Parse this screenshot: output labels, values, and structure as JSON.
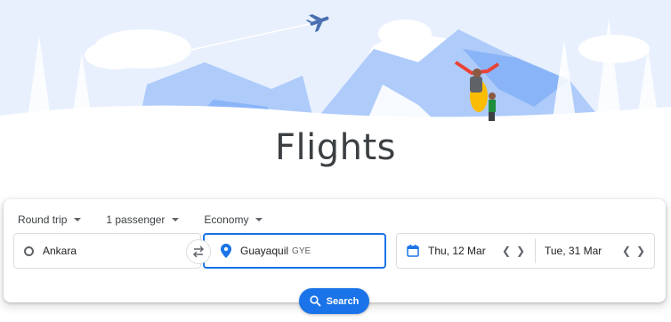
{
  "page": {
    "title": "Flights"
  },
  "options": {
    "trip_type": "Round trip",
    "passengers": "1 passenger",
    "cabin_class": "Economy"
  },
  "route": {
    "origin": "Ankara",
    "destination": "Guayaquil",
    "destination_code": "GYE"
  },
  "dates": {
    "departure": "Thu, 12 Mar",
    "return": "Tue, 31 Mar"
  },
  "search_button": {
    "label": "Search"
  },
  "colors": {
    "accent": "#1a73e8",
    "text": "#3c4043"
  }
}
